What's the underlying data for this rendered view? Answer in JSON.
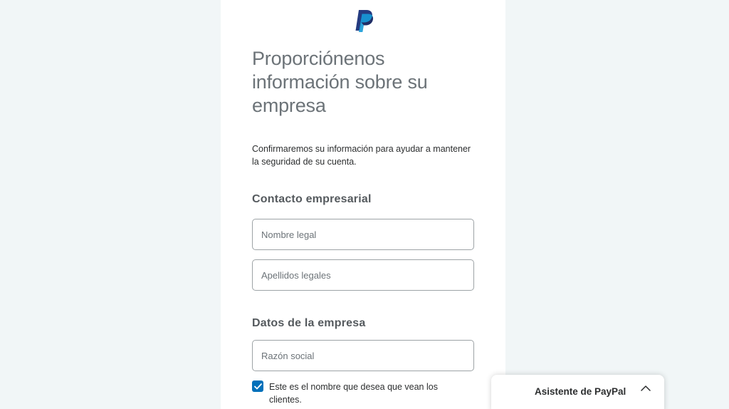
{
  "brand": {
    "logo_icon": "paypal-logo-icon",
    "color_dark": "#253b80",
    "color_light": "#179bd7"
  },
  "form": {
    "heading": "Proporciónenos información sobre su empresa",
    "subtitle": "Confirmaremos su información para ayudar a mantener la seguridad de su cuenta.",
    "contact_section": {
      "title": "Contacto empresarial",
      "first_name_placeholder": "Nombre legal",
      "last_name_placeholder": "Apellidos legales"
    },
    "company_section": {
      "title": "Datos de la empresa",
      "business_name_placeholder": "Razón social",
      "display_name_checkbox": {
        "label": "Este es el nombre que desea que vean los clientes.",
        "checked": true
      }
    }
  },
  "assistant": {
    "label": "Asistente de PayPal",
    "icon": "chevron-up-icon"
  },
  "colors": {
    "background": "#f1f6f7",
    "accent": "#0070ba"
  }
}
